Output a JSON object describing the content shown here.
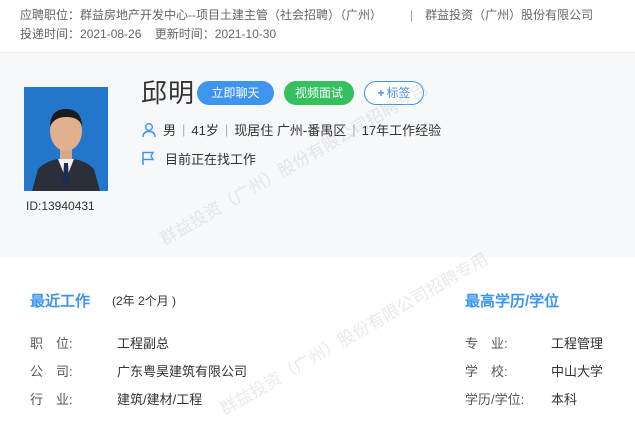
{
  "header": {
    "position_label": "应聘职位：",
    "position": "群益房地产开发中心--项目土建主管（社会招聘）（广州）",
    "separator": "|",
    "company": "群益投资（广州）股份有限公司",
    "submit_label": "投递时间：",
    "submit_date": "2021-08-26",
    "update_label": "更新时间：",
    "update_date": "2021-10-30"
  },
  "candidate": {
    "name": "邱明",
    "id_text": "ID:13940431",
    "gender": "男",
    "age": "41岁",
    "residence": "现居住 广州-番禺区",
    "experience": "17年工作经验",
    "status": "目前正在找工作",
    "divider": "|"
  },
  "actions": {
    "chat": "立即聊天",
    "video": "视频面试",
    "tag_plus": "+",
    "tag": "标签"
  },
  "recent_work": {
    "title": "最近工作",
    "duration": "(2年 2个月 )",
    "rows": [
      {
        "label": "职　位:",
        "value": "工程副总"
      },
      {
        "label": "公　司:",
        "value": "广东粤昊建筑有限公司"
      },
      {
        "label": "行　业:",
        "value": "建筑/建材/工程"
      }
    ]
  },
  "education": {
    "title": "最高学历/学位",
    "rows": [
      {
        "label": "专　业:",
        "value": "工程管理"
      },
      {
        "label": "学　校:",
        "value": "中山大学"
      },
      {
        "label": "学历/学位:",
        "value": "本科"
      }
    ]
  },
  "watermark": "群益投资（广州）股份有限公司招聘专用",
  "colors": {
    "accent": "#3f94ee",
    "green": "#35bf5f"
  }
}
